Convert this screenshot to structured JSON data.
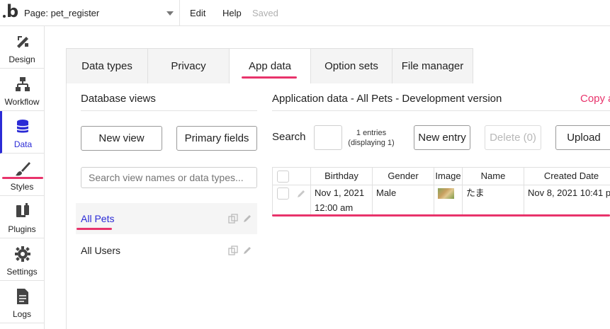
{
  "topbar": {
    "page_label": "Page: pet_register",
    "menu": [
      "Edit",
      "Help"
    ],
    "status": "Saved"
  },
  "sidebar": {
    "items": [
      {
        "label": "Design",
        "icon": "design-icon"
      },
      {
        "label": "Workflow",
        "icon": "workflow-icon"
      },
      {
        "label": "Data",
        "icon": "database-icon",
        "active": true
      },
      {
        "label": "Styles",
        "icon": "brush-icon"
      },
      {
        "label": "Plugins",
        "icon": "plug-icon"
      },
      {
        "label": "Settings",
        "icon": "gear-icon"
      },
      {
        "label": "Logs",
        "icon": "document-icon"
      }
    ]
  },
  "tabs": [
    {
      "label": "Data types"
    },
    {
      "label": "Privacy"
    },
    {
      "label": "App data",
      "active": true
    },
    {
      "label": "Option sets"
    },
    {
      "label": "File manager"
    }
  ],
  "database_views": {
    "title": "Database views",
    "new_view_label": "New view",
    "primary_fields_label": "Primary fields",
    "search_placeholder": "Search view names or data types...",
    "views": [
      {
        "label": "All Pets",
        "active": true
      },
      {
        "label": "All Users",
        "active": false
      }
    ]
  },
  "app_data": {
    "title": "Application data - All Pets - Development version",
    "copy_link": "Copy a",
    "search_label": "Search",
    "entries_line1": "1 entries",
    "entries_line2": "(displaying 1)",
    "new_entry_label": "New entry",
    "delete_label": "Delete (0)",
    "upload_label": "Upload",
    "columns": [
      "Birthday",
      "Gender",
      "Image",
      "Name",
      "Created Date"
    ],
    "rows": [
      {
        "birthday_line1": "Nov 1, 2021",
        "birthday_line2": "12:00 am",
        "gender": "Male",
        "name": "たま",
        "created_date": "Nov 8, 2021 10:41 pm"
      }
    ]
  },
  "colors": {
    "accent_pink": "#e8336b",
    "active_blue": "#2b2bd6"
  }
}
